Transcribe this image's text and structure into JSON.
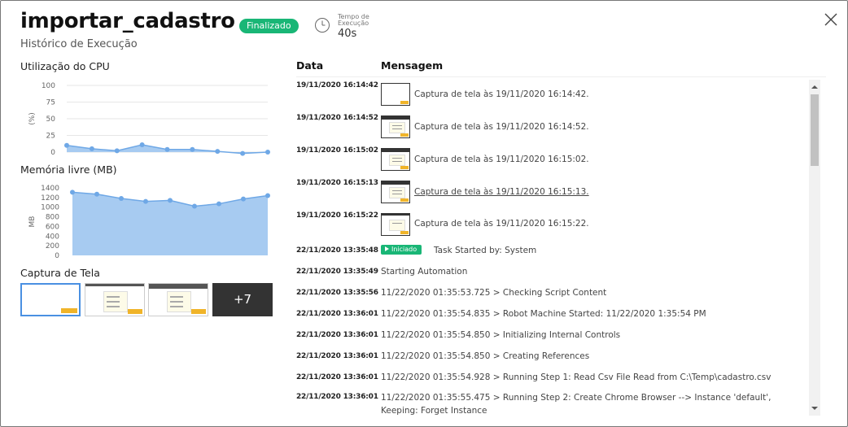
{
  "header": {
    "title": "importar_cadastro",
    "status": "Finalizado",
    "time_label": "Tempo de Execução",
    "time_value": "40s",
    "subtitle": "Histórico de Execução"
  },
  "colors": {
    "accent_green": "#19b676",
    "chart_blue": "#6fa8e6",
    "chart_fill": "#a7cbf1"
  },
  "cpu_section": {
    "title": "Utilização do CPU"
  },
  "memory_section": {
    "title": "Memória livre (MB)"
  },
  "screens_section": {
    "title": "Captura de Tela",
    "more_label": "+7"
  },
  "chart_data": [
    {
      "type": "area",
      "title": "Utilização do CPU",
      "ylabel": "(%)",
      "ylim": [
        0,
        100
      ],
      "yticks": [
        "100",
        "75",
        "50",
        "25",
        "0"
      ],
      "grid": true,
      "x": [
        1,
        2,
        3,
        4,
        5,
        6,
        7,
        8,
        9
      ],
      "values": [
        10,
        5,
        2,
        11,
        4,
        4,
        1,
        -2,
        0
      ]
    },
    {
      "type": "area",
      "title": "Memória livre (MB)",
      "ylabel": "MB",
      "ylim": [
        0,
        1400
      ],
      "yticks": [
        "1400",
        "1200",
        "1000",
        "800",
        "600",
        "400",
        "200",
        "0"
      ],
      "grid": false,
      "x": [
        1,
        2,
        3,
        4,
        5,
        6,
        7,
        8,
        9
      ],
      "values": [
        1310,
        1270,
        1180,
        1120,
        1140,
        1020,
        1070,
        1170,
        1240
      ]
    }
  ],
  "table": {
    "col_date": "Data",
    "col_message": "Mensagem",
    "rows": [
      {
        "date": "19/11/2020 16:14:42",
        "message": "Captura de tela às 19/11/2020 16:14:42."
      },
      {
        "date": "19/11/2020 16:14:52",
        "message": "Captura de tela às 19/11/2020 16:14:52."
      },
      {
        "date": "19/11/2020 16:15:02",
        "message": "Captura de tela às 19/11/2020 16:15:02."
      },
      {
        "date": "19/11/2020 16:15:13",
        "message": "Captura de tela às 19/11/2020 16:15:13."
      },
      {
        "date": "19/11/2020 16:15:22",
        "message": "Captura de tela às 19/11/2020 16:15:22."
      },
      {
        "date": "22/11/2020 13:35:48",
        "badge": "Iniciado",
        "message": "Task Started by: System"
      },
      {
        "date": "22/11/2020 13:35:49",
        "message": "Starting Automation"
      },
      {
        "date": "22/11/2020 13:35:56",
        "message": "11/22/2020 01:35:53.725 > Checking Script Content"
      },
      {
        "date": "22/11/2020 13:36:01",
        "message": "11/22/2020 01:35:54.835 > Robot Machine Started: 11/22/2020 1:35:54 PM"
      },
      {
        "date": "22/11/2020 13:36:01",
        "message": "11/22/2020 01:35:54.850 > Initializing Internal Controls"
      },
      {
        "date": "22/11/2020 13:36:01",
        "message": "11/22/2020 01:35:54.850 > Creating References"
      },
      {
        "date": "22/11/2020 13:36:01",
        "message": "11/22/2020 01:35:54.928 > Running Step 1: Read Csv File Read from C:\\Temp\\cadastro.csv"
      },
      {
        "date": "22/11/2020 13:36:01",
        "message": "11/22/2020 01:35:55.475 > Running Step 2: Create Chrome Browser --> Instance 'default', Keeping: Forget Instance"
      }
    ]
  }
}
